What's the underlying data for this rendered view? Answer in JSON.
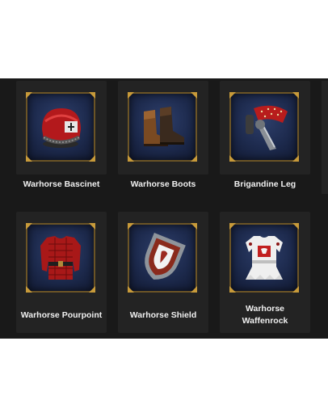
{
  "items": [
    {
      "name": "Warhorse Bascinet",
      "icon": "helmet-icon"
    },
    {
      "name": "Warhorse Boots",
      "icon": "boots-icon"
    },
    {
      "name": "Brigandine Leg",
      "icon": "leg-armor-icon"
    },
    {
      "name": "Warhorse Pourpoint",
      "icon": "pourpoint-icon"
    },
    {
      "name": "Warhorse Shield",
      "icon": "shield-icon"
    },
    {
      "name": "Warhorse Waffenrock",
      "icon": "waffenrock-icon"
    }
  ]
}
